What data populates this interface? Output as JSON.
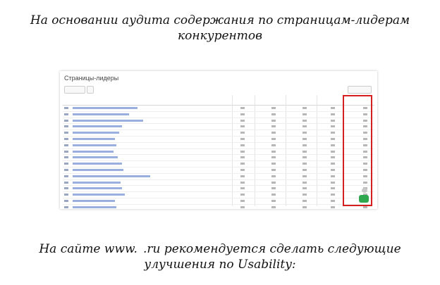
{
  "heading_top": {
    "line1": "На основании аудита содержания по страницам-лидерам",
    "line2": "конкурентов"
  },
  "screenshot": {
    "title": "Страницы-лидеры",
    "row_count": 20
  },
  "heading_bottom": {
    "prefix": "На сайте www.",
    "domain_masked": "",
    "suffix": ".ru рекомендуется сделать следующие",
    "line2": "улучшения по Usability:"
  }
}
